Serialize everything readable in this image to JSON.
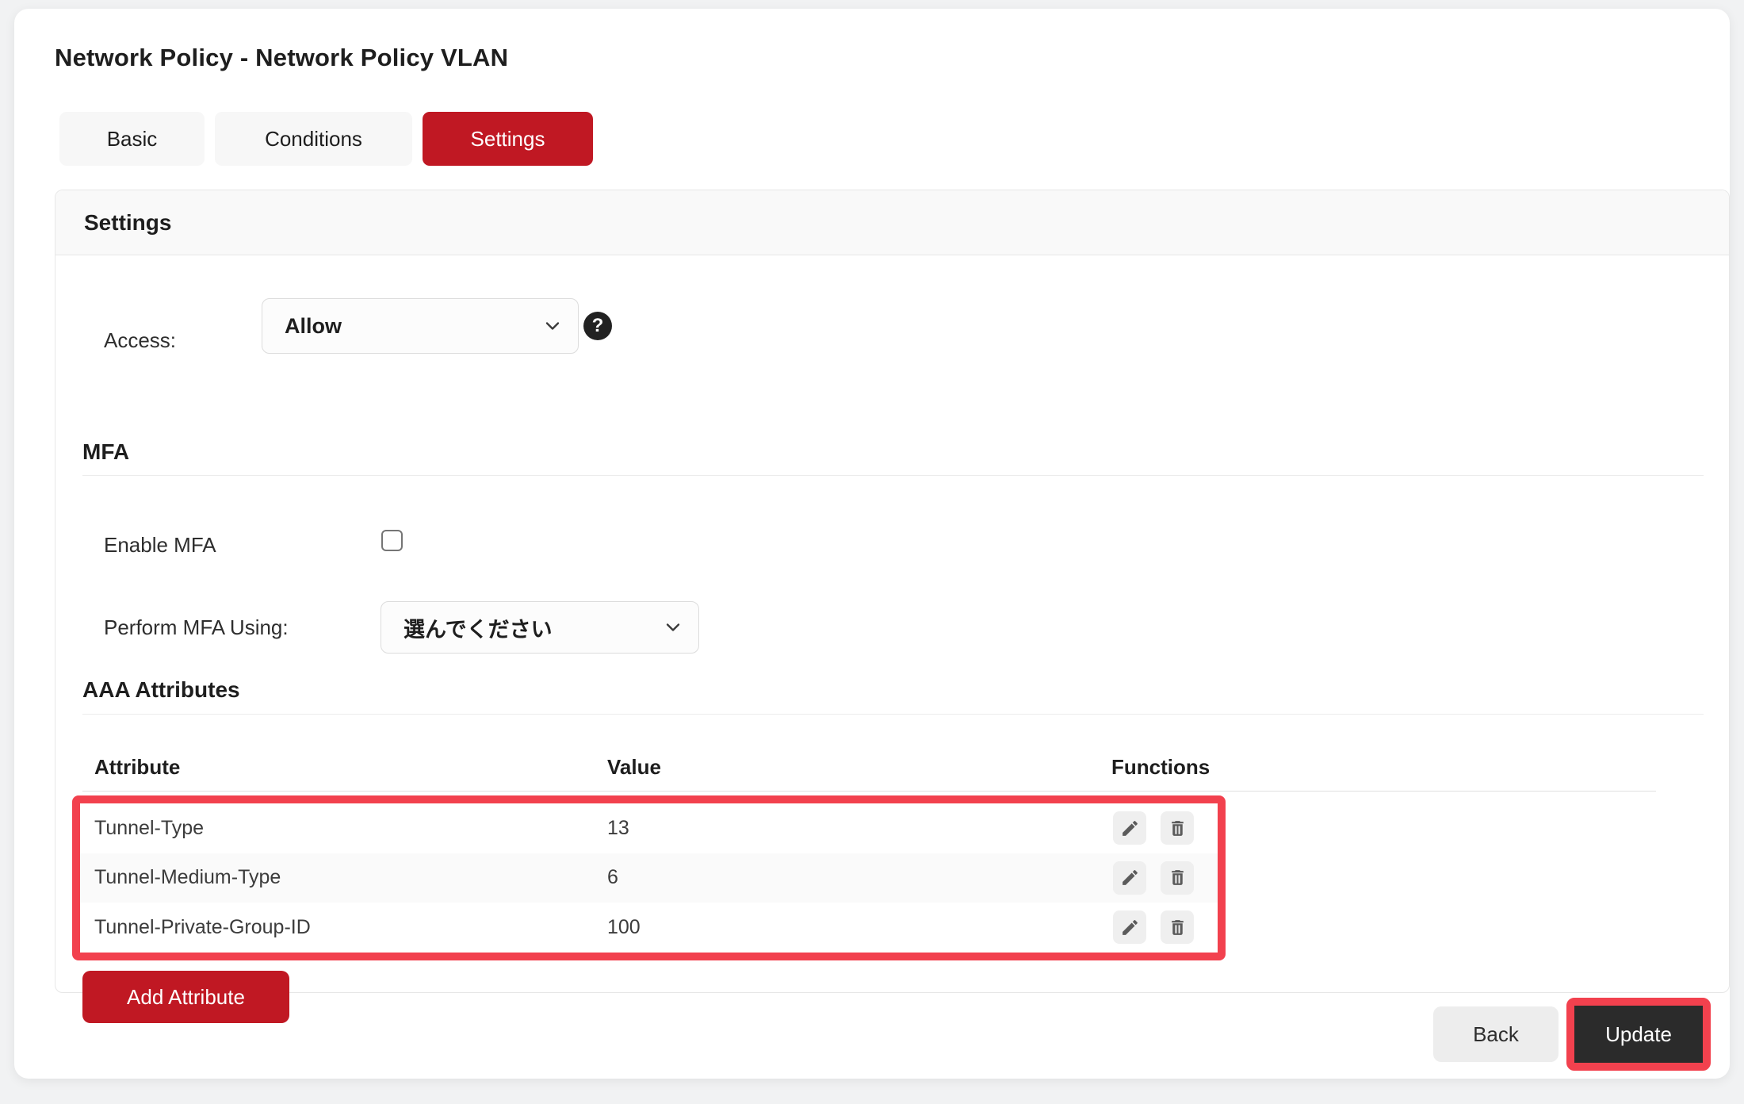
{
  "page": {
    "title": "Network Policy - Network Policy VLAN"
  },
  "tabs": [
    {
      "label": "Basic",
      "active": false
    },
    {
      "label": "Conditions",
      "active": false
    },
    {
      "label": "Settings",
      "active": true
    }
  ],
  "settings_card": {
    "header": "Settings",
    "access": {
      "label": "Access:",
      "selected": "Allow",
      "help_glyph": "?"
    },
    "mfa": {
      "heading": "MFA",
      "enable_label": "Enable MFA",
      "enable_checked": false,
      "perform_label": "Perform MFA Using:",
      "perform_selected": "選んでください"
    },
    "aaa": {
      "heading": "AAA Attributes",
      "columns": [
        "Attribute",
        "Value",
        "Functions"
      ],
      "rows": [
        {
          "attribute": "Tunnel-Type",
          "value": "13"
        },
        {
          "attribute": "Tunnel-Medium-Type",
          "value": "6"
        },
        {
          "attribute": "Tunnel-Private-Group-ID",
          "value": "100"
        }
      ],
      "add_button": "Add Attribute"
    }
  },
  "footer": {
    "back_label": "Back",
    "update_label": "Update"
  },
  "colors": {
    "accent_red": "#c01823",
    "highlight_red": "#f2414e",
    "dark_button": "#2b2b2b",
    "page_background": "#f1f2f3"
  }
}
